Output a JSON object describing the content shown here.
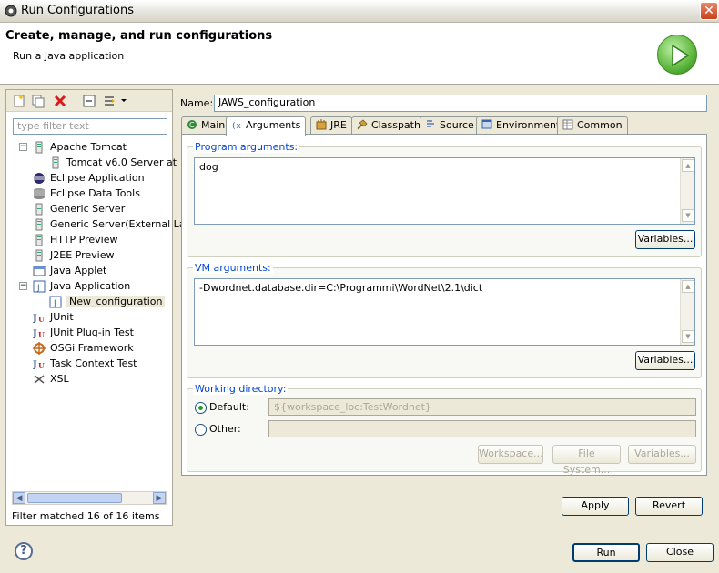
{
  "window": {
    "title": "Run Configurations",
    "close_glyph": "✕"
  },
  "banner": {
    "headline": "Create, manage, and run configurations",
    "subtitle": "Run a Java application",
    "icon": "run-icon"
  },
  "left": {
    "toolbar": [
      "new-config-icon",
      "duplicate-icon",
      "delete-icon",
      "collapse-all-icon",
      "filter-icon"
    ],
    "filter_placeholder": "type filter text",
    "tree": [
      {
        "label": "Apache Tomcat",
        "icon": "server-icon",
        "expanded": true
      },
      {
        "label": "Tomcat v6.0 Server at",
        "icon": "server-icon",
        "child": true
      },
      {
        "label": "Eclipse Application",
        "icon": "eclipse-icon"
      },
      {
        "label": "Eclipse Data Tools",
        "icon": "database-icon"
      },
      {
        "label": "Generic Server",
        "icon": "server-icon"
      },
      {
        "label": "Generic Server(External La",
        "icon": "server-icon"
      },
      {
        "label": "HTTP Preview",
        "icon": "server-icon"
      },
      {
        "label": "J2EE Preview",
        "icon": "server-icon"
      },
      {
        "label": "Java Applet",
        "icon": "applet-icon"
      },
      {
        "label": "Java Application",
        "icon": "java-app-icon",
        "expanded": true
      },
      {
        "label": "New_configuration",
        "icon": "java-app-icon",
        "child": true,
        "selected": true
      },
      {
        "label": "JUnit",
        "icon": "junit-icon"
      },
      {
        "label": "JUnit Plug-in Test",
        "icon": "junit-icon"
      },
      {
        "label": "OSGi Framework",
        "icon": "osgi-icon"
      },
      {
        "label": "Task Context Test",
        "icon": "junit-icon"
      },
      {
        "label": "XSL",
        "icon": "xsl-icon"
      }
    ],
    "status": "Filter matched 16 of 16 items"
  },
  "right": {
    "name_label": "Name:",
    "name_value": "JAWS_configuration",
    "tabs": [
      {
        "label": "Main",
        "icon": "main-tab-icon"
      },
      {
        "label": "Arguments",
        "icon": "arguments-tab-icon",
        "active": true
      },
      {
        "label": "JRE",
        "icon": "jre-tab-icon"
      },
      {
        "label": "Classpath",
        "icon": "classpath-tab-icon"
      },
      {
        "label": "Source",
        "icon": "source-tab-icon"
      },
      {
        "label": "Environment",
        "icon": "environment-tab-icon"
      },
      {
        "label": "Common",
        "icon": "common-tab-icon"
      }
    ],
    "program_args": {
      "label": "Program arguments:",
      "value": "dog",
      "variables_button": "Variables..."
    },
    "vm_args": {
      "label": "VM arguments:",
      "value": "-Dwordnet.database.dir=C:\\Programmi\\WordNet\\2.1\\dict",
      "variables_button": "Variables..."
    },
    "working_dir": {
      "label": "Working directory:",
      "default_label": "Default:",
      "default_value": "${workspace_loc:TestWordnet}",
      "other_label": "Other:",
      "other_value": "",
      "workspace_button": "Workspace...",
      "filesystem_button": "File System...",
      "variables_button": "Variables..."
    },
    "apply_button": "Apply",
    "revert_button": "Revert"
  },
  "footer": {
    "help": "?",
    "run_button": "Run",
    "close_button": "Close"
  }
}
